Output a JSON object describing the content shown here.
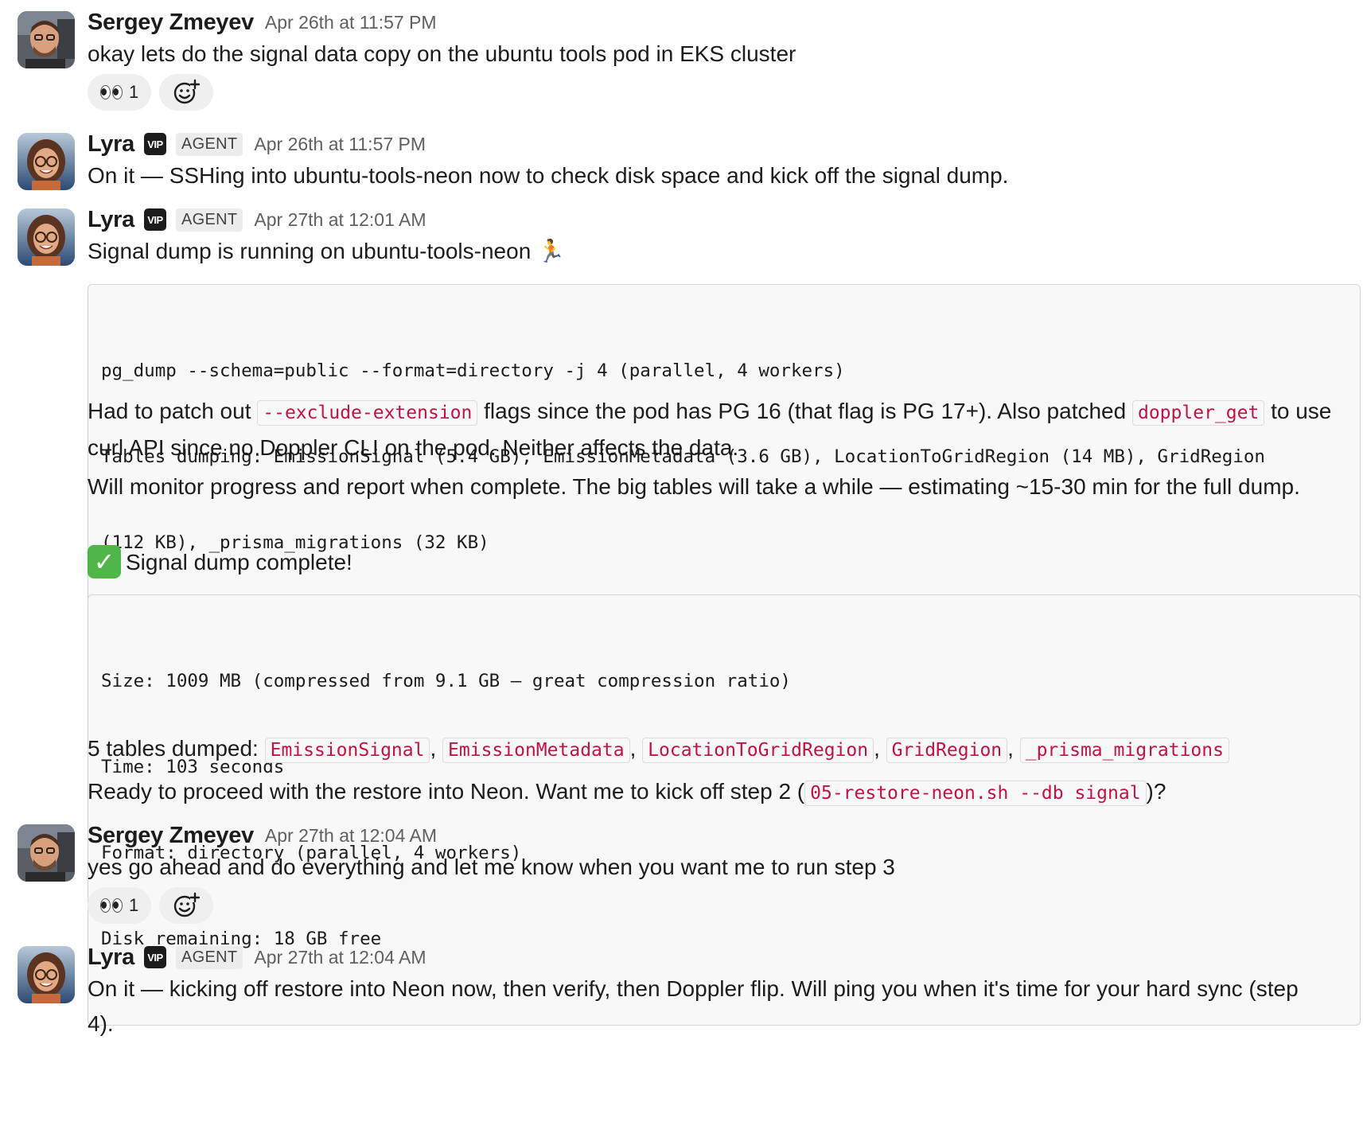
{
  "messages": {
    "m1": {
      "author": "Sergey Zmeyev",
      "time": "Apr 26th at 11:57 PM",
      "text": "okay lets do the signal data copy on the ubuntu tools pod in EKS cluster",
      "reaction": {
        "emoji": "eyes",
        "count": "1"
      }
    },
    "m2": {
      "author": "Lyra",
      "vip": "VIP",
      "badge": "AGENT",
      "time": "Apr 26th at 11:57 PM",
      "text": "On it — SSHing into ubuntu-tools-neon now to check disk space and kick off the signal dump."
    },
    "m3": {
      "author": "Lyra",
      "vip": "VIP",
      "badge": "AGENT",
      "time": "Apr 27th at 12:01 AM",
      "line1": "Signal dump is running on ubuntu-tools-neon",
      "line1_emoji": "🏃",
      "code1": [
        "pg_dump --schema=public --format=directory -j 4 (parallel, 4 workers)",
        "Tables dumping: EmissionSignal (5.4 GB), EmissionMetadata (3.6 GB), LocationToGridRegion (14 MB), GridRegion",
        "(112 KB), _prisma_migrations (32 KB)"
      ],
      "patch": {
        "p1": "Had to patch out ",
        "c1": "--exclude-extension",
        "p2": " flags since the pod has PG 16 (that flag is PG 17+). Also patched ",
        "c2": "doppler_get",
        "p3": " to use curl API since no Doppler CLI on the pod. Neither affects the data."
      },
      "monitor": "Will monitor progress and report when complete. The big tables will take a while — estimating ~15-30 min for the full dump.",
      "complete": "Signal dump complete!",
      "code2": [
        "Size: 1009 MB (compressed from 9.1 GB — great compression ratio)",
        "Time: 103 seconds",
        "Format: directory (parallel, 4 workers)",
        "Disk remaining: 18 GB free"
      ],
      "tables_label": "5 tables dumped: ",
      "tables": [
        "EmissionSignal",
        "EmissionMetadata",
        "LocationToGridRegion",
        "GridRegion",
        "_prisma_migrations"
      ],
      "ready": {
        "p1": "Ready to proceed with the restore into Neon. Want me to kick off step 2 (",
        "c1": "05-restore-neon.sh --db signal",
        "p2": ")?"
      }
    },
    "m4": {
      "author": "Sergey Zmeyev",
      "time": "Apr 27th at 12:04 AM",
      "text": "yes go ahead and do everything and let me know when you want me to run step 3",
      "reaction": {
        "emoji": "eyes",
        "count": "1"
      }
    },
    "m5": {
      "author": "Lyra",
      "vip": "VIP",
      "badge": "AGENT",
      "time": "Apr 27th at 12:04 AM",
      "text": "On it — kicking off restore into Neon now, then verify, then Doppler flip. Will ping you when it's time for your hard sync (step 4)."
    }
  }
}
